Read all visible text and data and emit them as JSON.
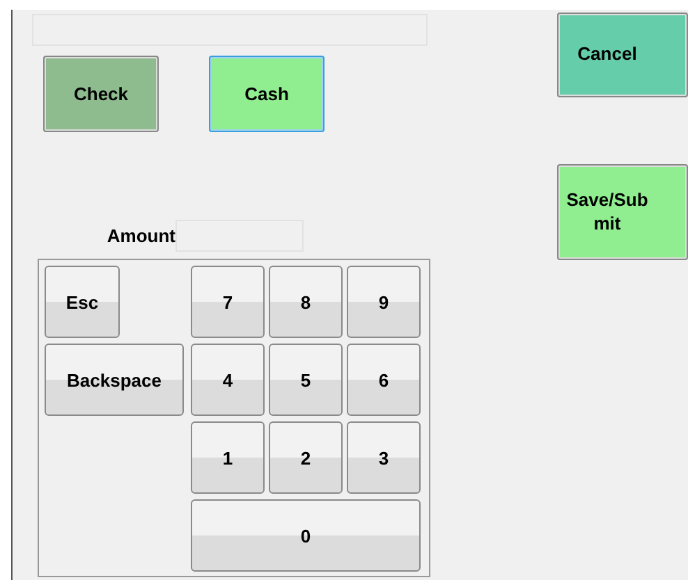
{
  "payment_types": [
    {
      "label": "Check",
      "selected": false,
      "color": "#8fbc8f"
    },
    {
      "label": "Cash",
      "selected": true,
      "color": "#90ee90"
    }
  ],
  "amount": {
    "label": "Amount"
  },
  "keypad": {
    "command_keys": [
      {
        "label": "Esc",
        "kind": "narrow"
      },
      {
        "label": "Backspace",
        "kind": "wide"
      }
    ],
    "digit_keys": [
      {
        "label": "7",
        "kind": "single"
      },
      {
        "label": "8",
        "kind": "single"
      },
      {
        "label": "9",
        "kind": "single"
      },
      {
        "label": "4",
        "kind": "single"
      },
      {
        "label": "5",
        "kind": "single"
      },
      {
        "label": "6",
        "kind": "single"
      },
      {
        "label": "1",
        "kind": "single"
      },
      {
        "label": "2",
        "kind": "single"
      },
      {
        "label": "3",
        "kind": "single"
      },
      {
        "label": "0",
        "kind": "wide"
      }
    ]
  },
  "actions": [
    {
      "label": "Cancel",
      "color": "#66cdaa"
    },
    {
      "label": "Save/Submit",
      "color": "#90ee90"
    }
  ]
}
